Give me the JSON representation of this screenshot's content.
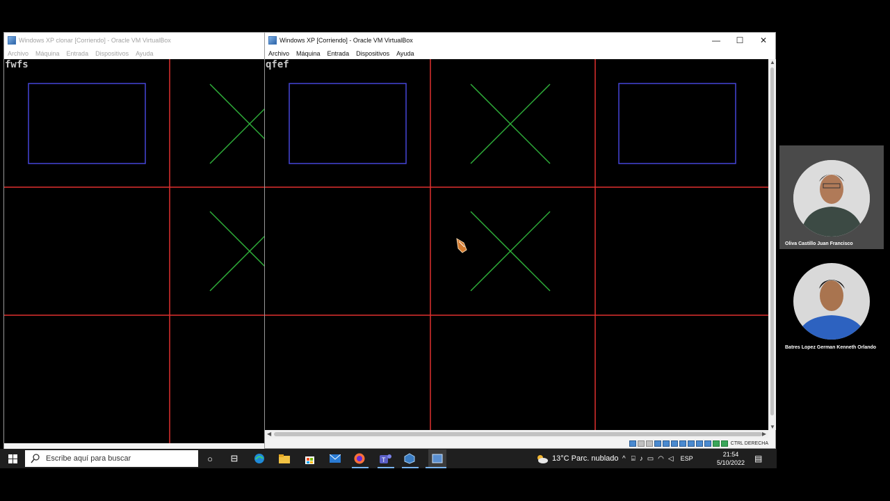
{
  "back_window": {
    "title": "Windows XP clonar [Corriendo] - Oracle VM VirtualBox",
    "menu": [
      "Archivo",
      "Máquina",
      "Entrada",
      "Dispositivos",
      "Ayuda"
    ],
    "vm_text": "fwfs"
  },
  "front_window": {
    "title": "Windows XP [Corriendo] - Oracle VM VirtualBox",
    "menu": [
      "Archivo",
      "Máquina",
      "Entrada",
      "Dispositivos",
      "Ayuda"
    ],
    "vm_text": "qfef",
    "controls": {
      "minimize": "—",
      "maximize": "☐",
      "close": "✕"
    },
    "status_host_key": "CTRL DERECHA",
    "board": [
      "O",
      "X",
      "O",
      "",
      "X",
      "",
      "",
      "",
      ""
    ],
    "colors": {
      "grid": "#e0312f",
      "o_box": "#4545d8",
      "x_mark": "#2fae3a"
    }
  },
  "participants": [
    {
      "name": "Oliva Castillo Juan Francisco"
    },
    {
      "name": "Batres Lopez German Kenneth Orlando"
    }
  ],
  "taskbar": {
    "search_placeholder": "Escribe aquí para buscar",
    "weather": "13°C  Parc. nublado",
    "language": "ESP",
    "time": "21:54",
    "date": "5/10/2022"
  }
}
